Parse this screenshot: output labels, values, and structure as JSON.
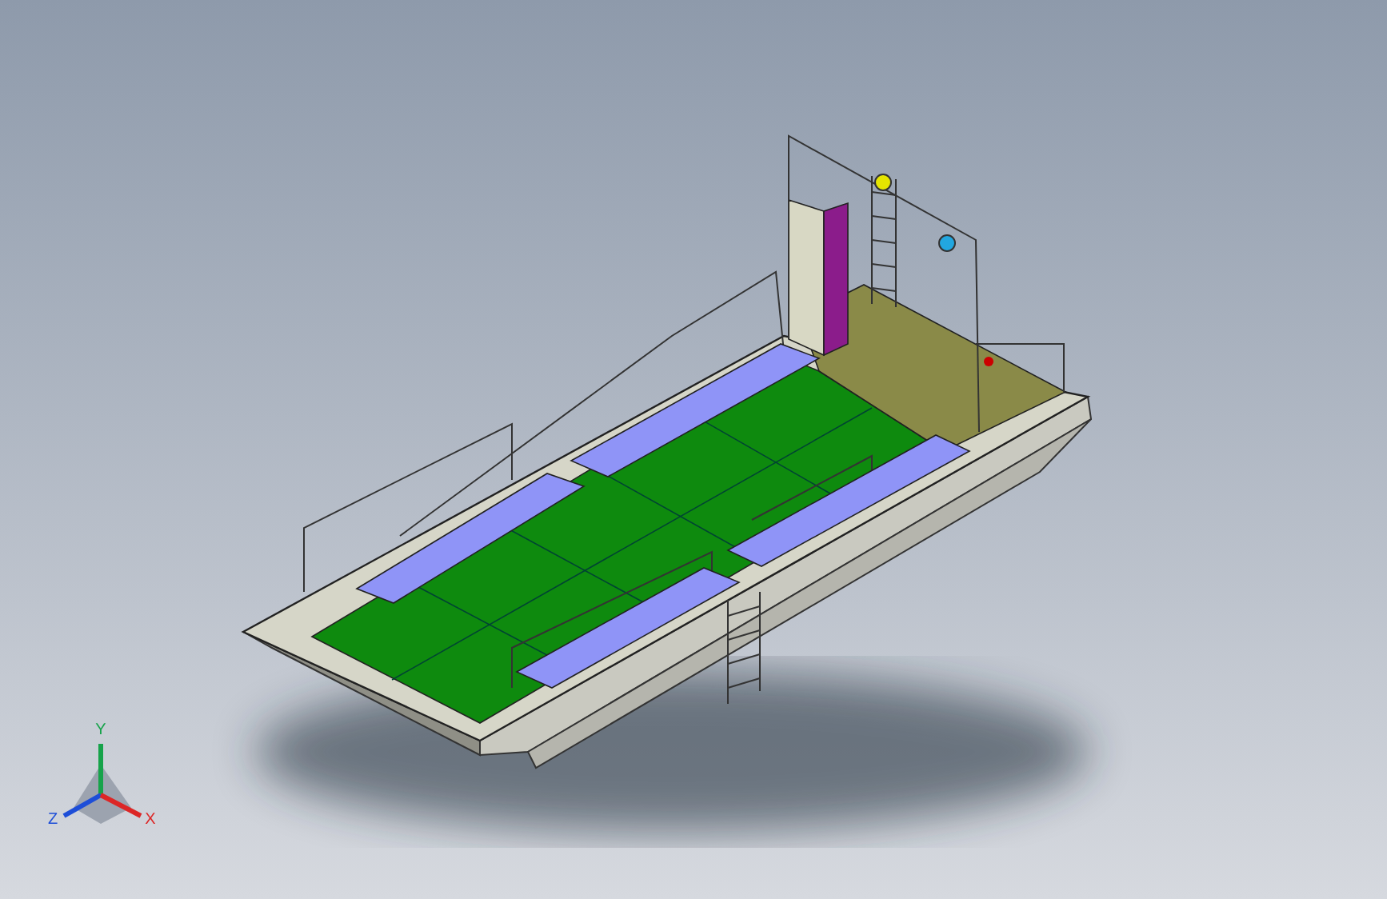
{
  "axis_triad": {
    "labels": [
      {
        "kind": "y",
        "text": "Y"
      },
      {
        "kind": "z",
        "text": "Z"
      },
      {
        "kind": "x",
        "text": "X"
      }
    ]
  }
}
